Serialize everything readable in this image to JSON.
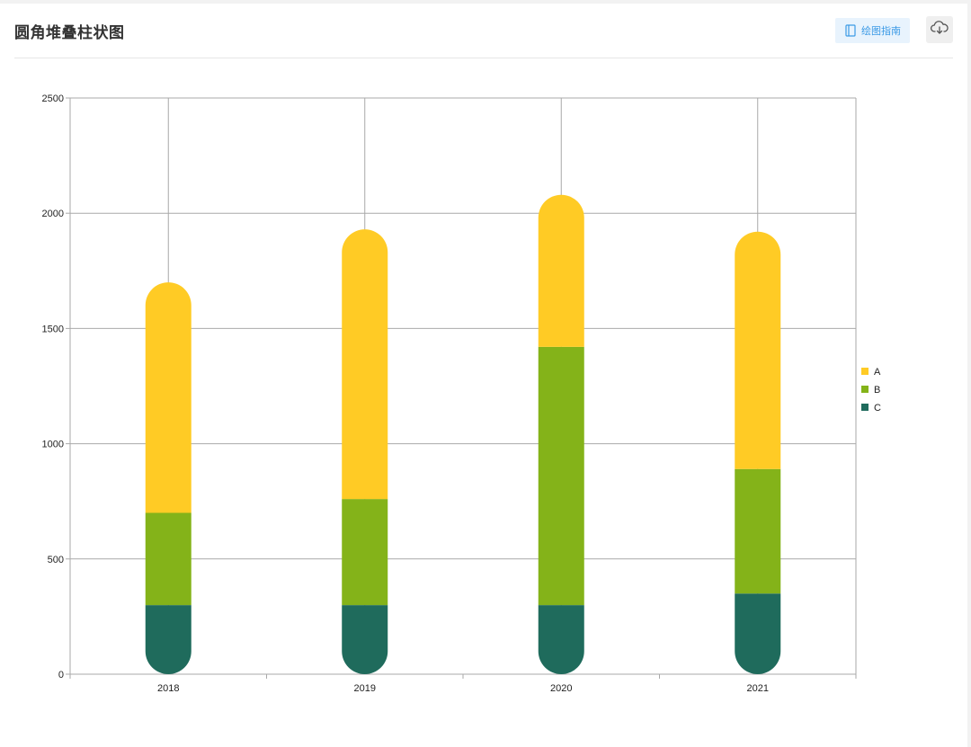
{
  "header": {
    "title": "圆角堆叠柱状图",
    "guide_label": "绘图指南"
  },
  "icons": {
    "guide": "book-icon",
    "download": "cloud-download-icon"
  },
  "chart_data": {
    "type": "bar",
    "stacked": true,
    "rounded_ends": true,
    "categories": [
      "2018",
      "2019",
      "2020",
      "2021"
    ],
    "series": [
      {
        "name": "C",
        "color": "#1f6b5c",
        "values": [
          300,
          300,
          300,
          350
        ]
      },
      {
        "name": "B",
        "color": "#84b319",
        "values": [
          400,
          460,
          1120,
          540
        ]
      },
      {
        "name": "A",
        "color": "#ffcb25",
        "values": [
          1000,
          1170,
          660,
          1030
        ]
      }
    ],
    "legend_order": [
      "A",
      "B",
      "C"
    ],
    "ylim": [
      0,
      2500
    ],
    "yticks": [
      0,
      500,
      1000,
      1500,
      2000,
      2500
    ],
    "grid": true,
    "legend_position": "right",
    "title": "",
    "xlabel": "",
    "ylabel": ""
  }
}
